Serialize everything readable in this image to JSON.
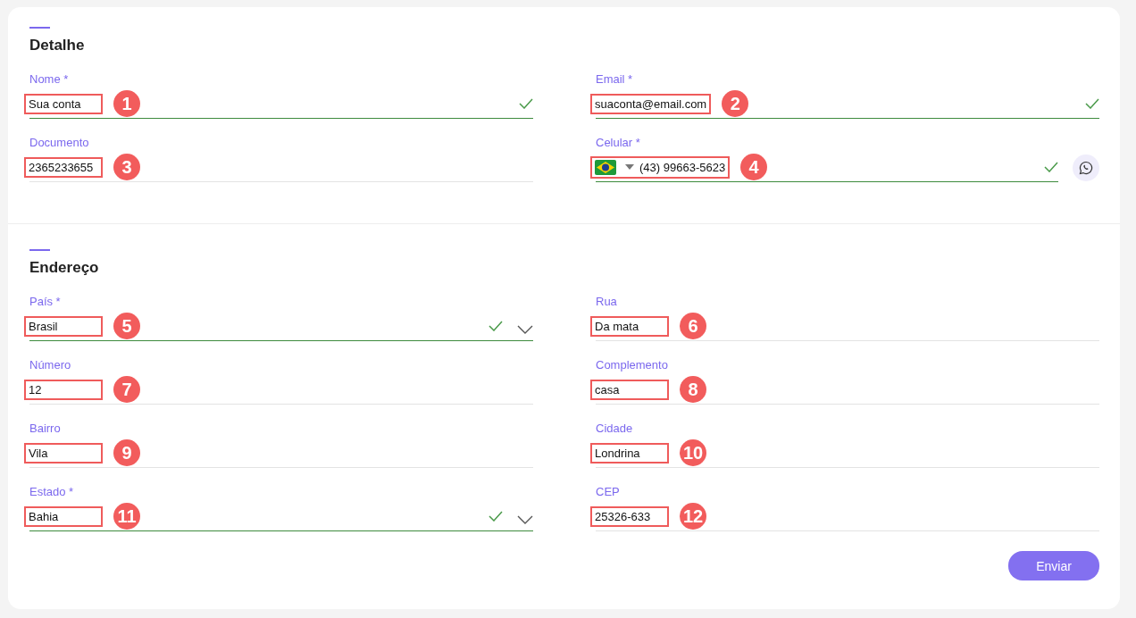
{
  "sections": [
    {
      "title": "Detalhe",
      "fields": [
        {
          "label": "Nome *",
          "value": "Sua conta",
          "kind": "text",
          "valid": true,
          "marker": "1"
        },
        {
          "label": "Email *",
          "value": "suaconta@email.com",
          "kind": "text",
          "valid": true,
          "marker": "2"
        },
        {
          "label": "Documento",
          "value": "2365233655",
          "kind": "text",
          "valid": false,
          "marker": "3"
        },
        {
          "label": "Celular *",
          "value": "(43) 99663-5623",
          "kind": "phone",
          "valid": true,
          "marker": "4"
        }
      ]
    },
    {
      "title": "Endereço",
      "fields": [
        {
          "label": "País *",
          "value": "Brasil",
          "kind": "select",
          "valid": true,
          "marker": "5"
        },
        {
          "label": "Rua",
          "value": "Da mata",
          "kind": "text",
          "valid": false,
          "marker": "6"
        },
        {
          "label": "Número",
          "value": "12",
          "kind": "text",
          "valid": false,
          "marker": "7"
        },
        {
          "label": "Complemento",
          "value": "casa",
          "kind": "text",
          "valid": false,
          "marker": "8"
        },
        {
          "label": "Bairro",
          "value": "Vila",
          "kind": "text",
          "valid": false,
          "marker": "9"
        },
        {
          "label": "Cidade",
          "value": "Londrina",
          "kind": "text",
          "valid": false,
          "marker": "10"
        },
        {
          "label": "Estado *",
          "value": "Bahia",
          "kind": "select",
          "valid": true,
          "marker": "11"
        },
        {
          "label": "CEP",
          "value": "25326-633",
          "kind": "text",
          "valid": false,
          "marker": "12"
        }
      ]
    }
  ],
  "submit": "Enviar"
}
